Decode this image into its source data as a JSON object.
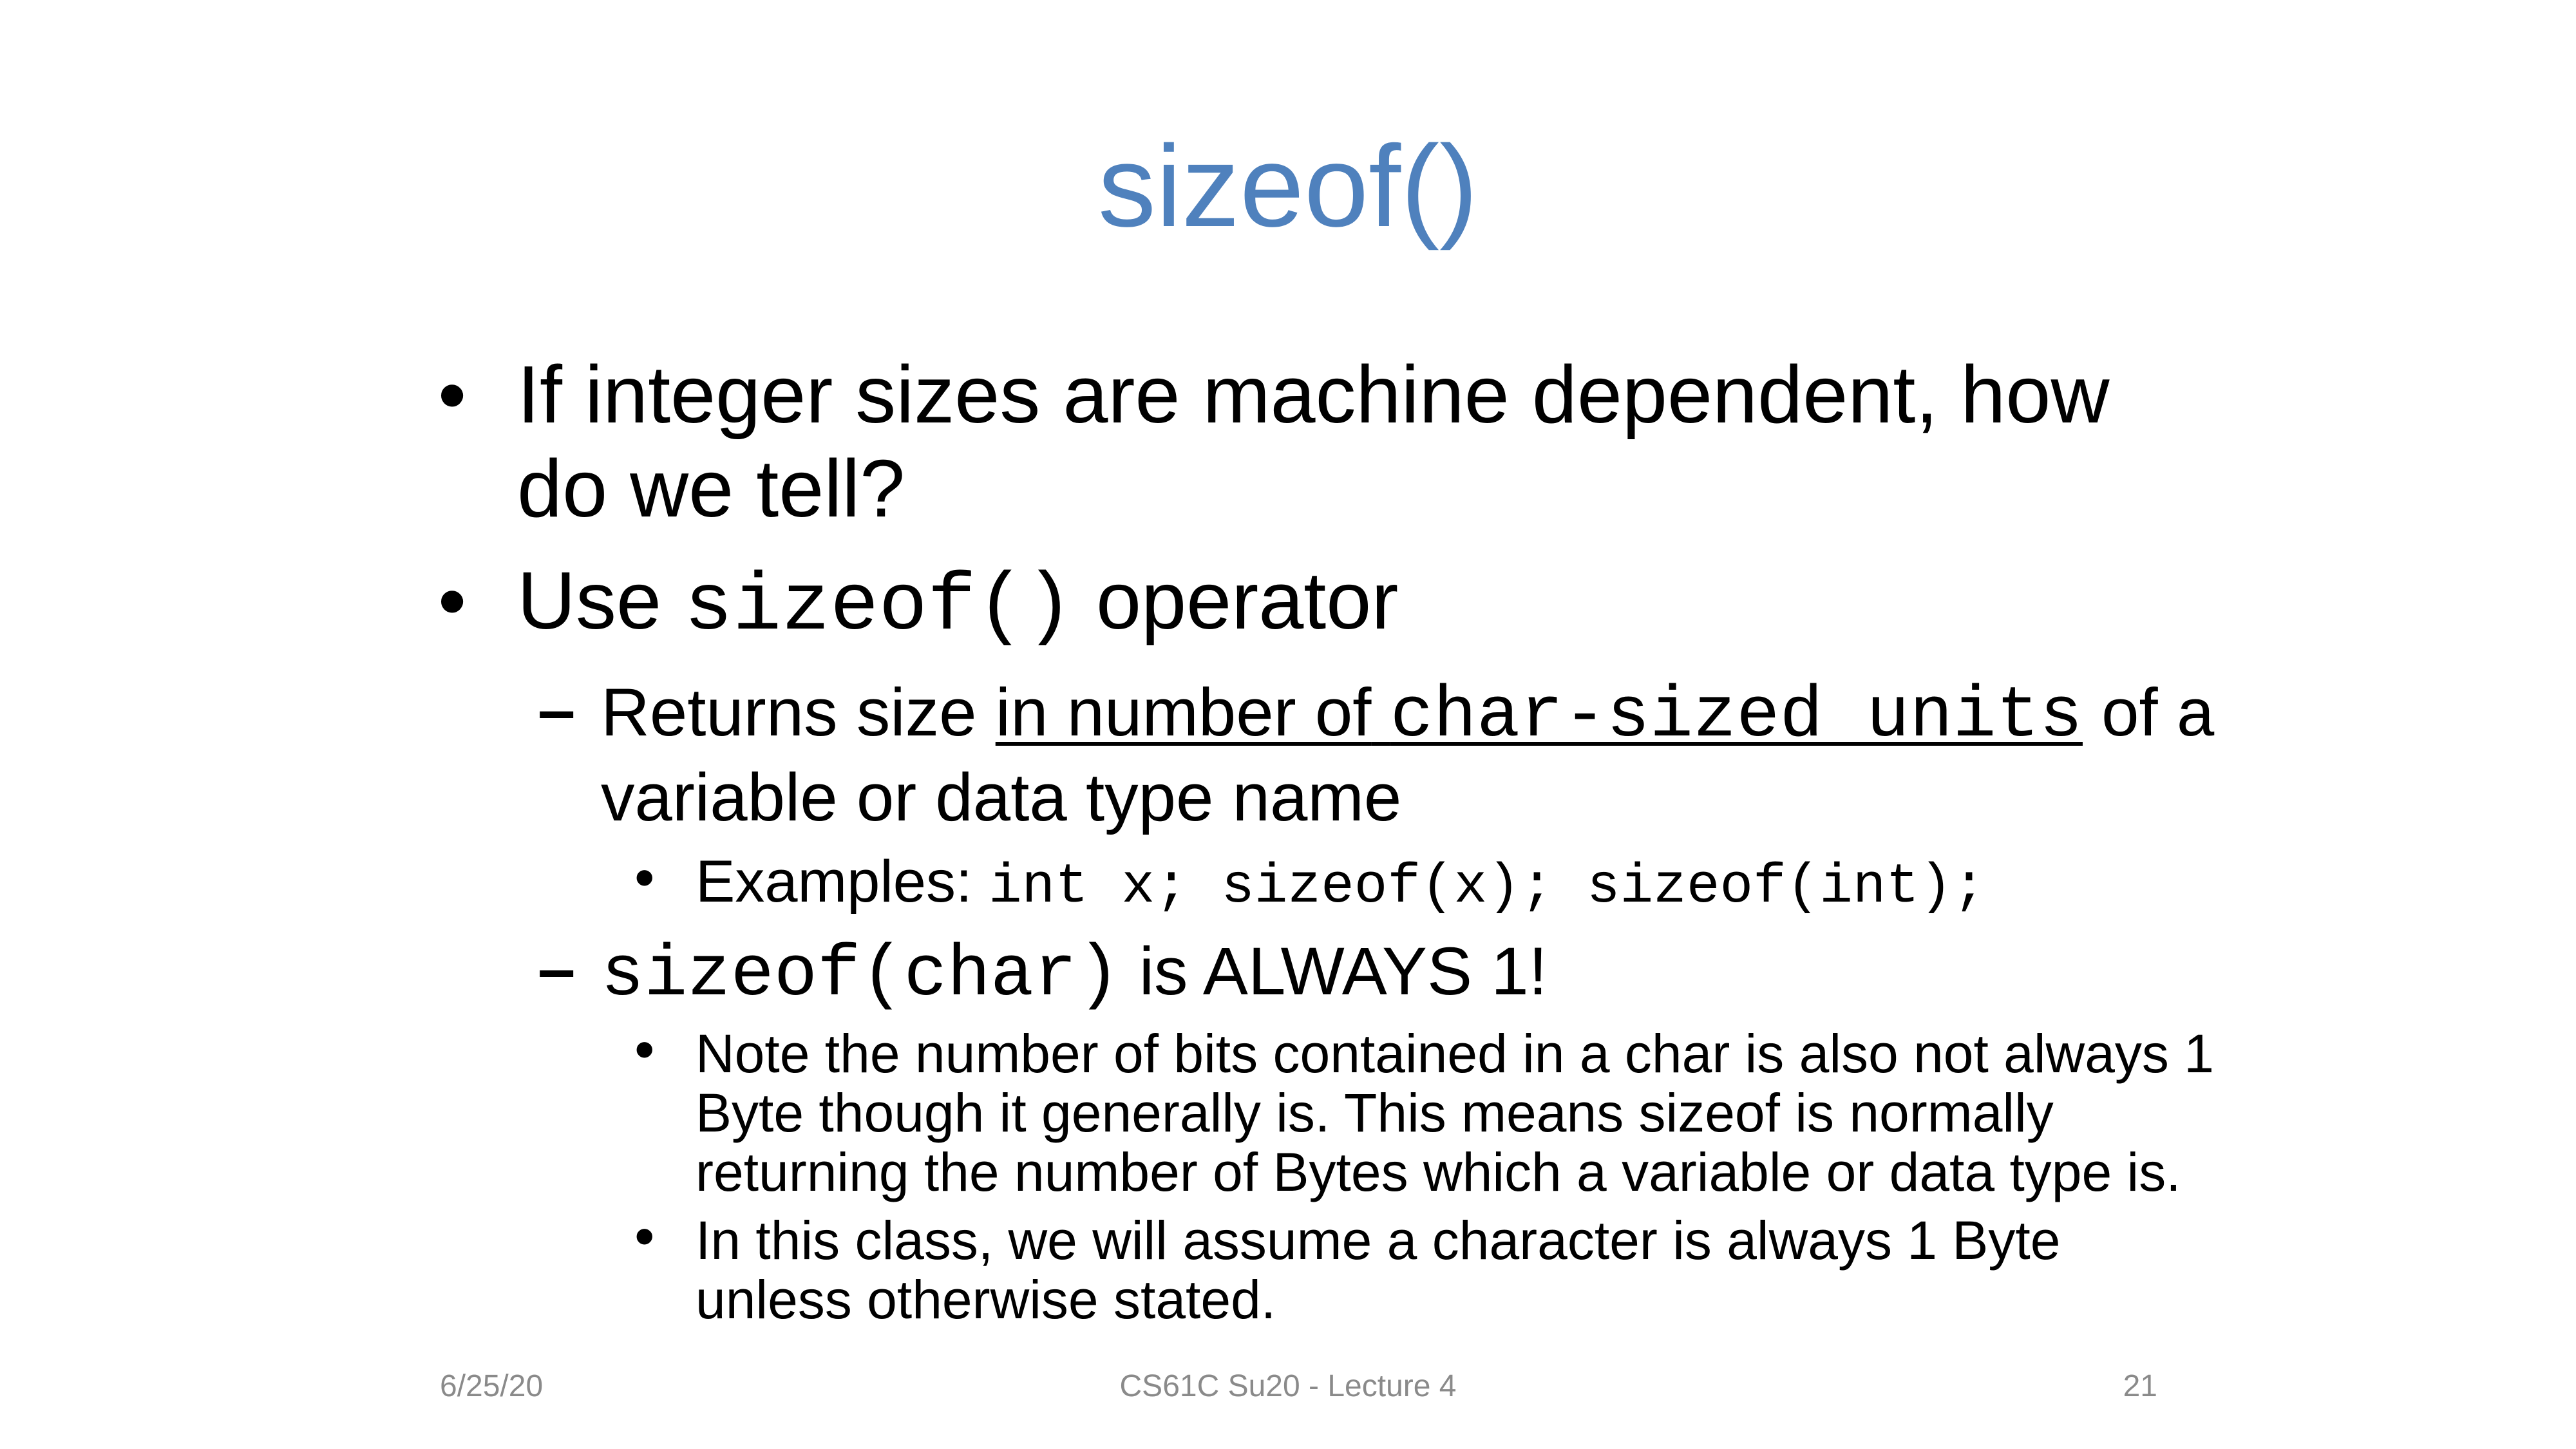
{
  "slide": {
    "title": "sizeof()",
    "bullets": {
      "b1": "If integer sizes are machine dependent, how do we tell?",
      "b2_prefix": "Use",
      "b2_code": "sizeof()",
      "b2_suffix": "operator",
      "sub1_text1": "Returns size",
      "sub1_underline_text": "in number of",
      "sub1_underline_code": "char-sized units",
      "sub1_text2": "of a variable or data type name",
      "examples_label": "Examples:",
      "examples_code": "int x; sizeof(x); sizeof(int);",
      "sub2_code": "sizeof(char)",
      "sub2_text": "is ALWAYS 1!",
      "note1": "Note the number of bits contained in a char is also not always 1 Byte though it generally is. This means sizeof is normally returning the number of Bytes which a variable or data type is.",
      "note2": "In this class, we will assume a character is always 1 Byte unless otherwise stated."
    },
    "footer": {
      "date": "6/25/20",
      "course": "CS61C Su20 - Lecture 4",
      "page": "21"
    }
  },
  "colors": {
    "title": "#4f81bd",
    "footer": "#8a8a8a"
  }
}
